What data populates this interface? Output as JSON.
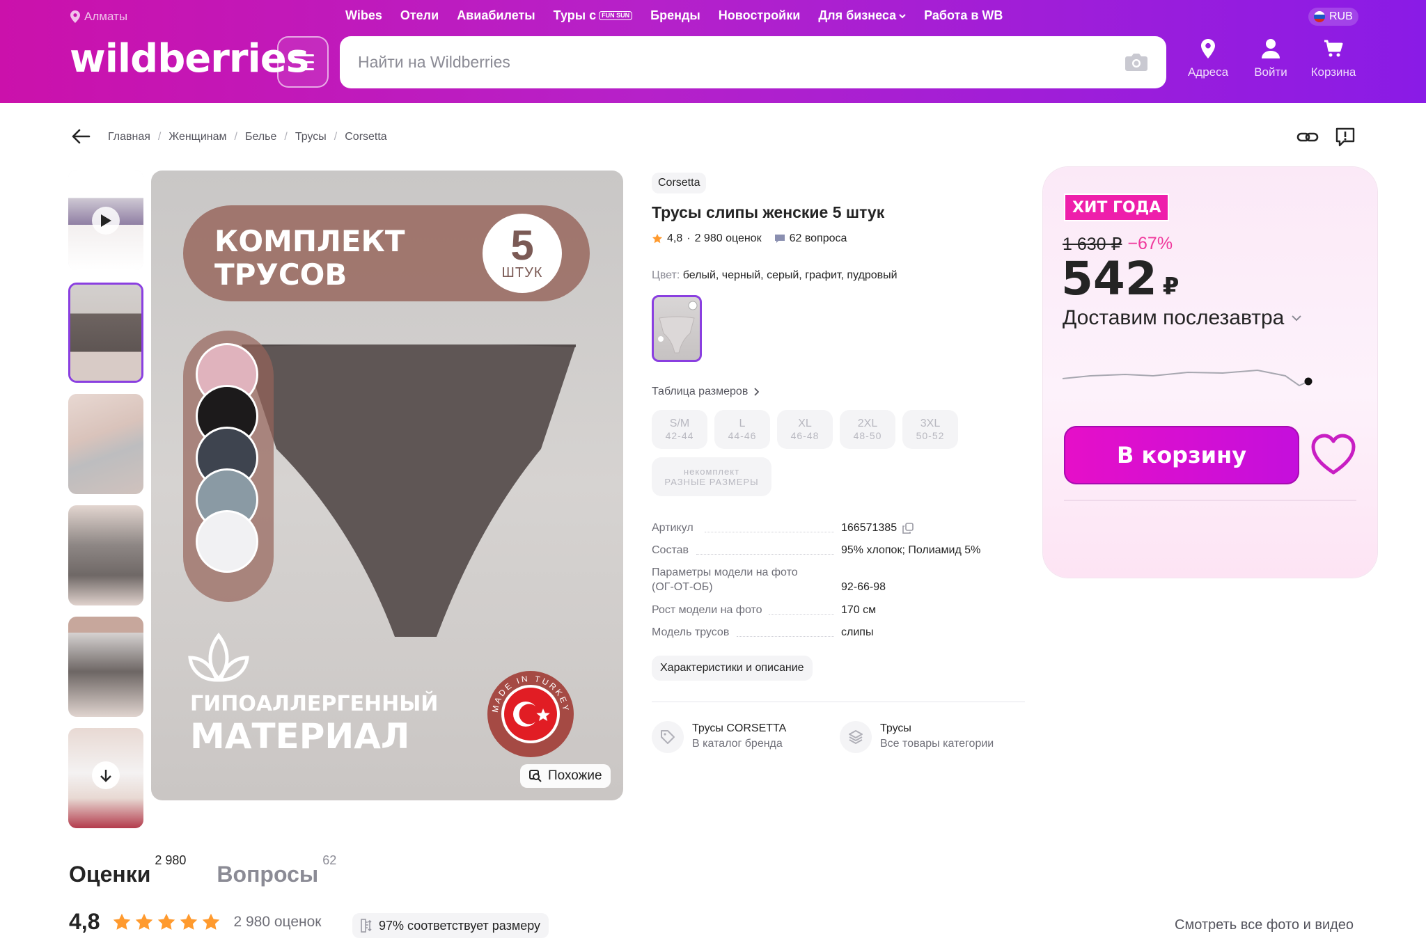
{
  "colors": {
    "accent": "#cb11ab",
    "accent_purple": "#8a1be6",
    "selected_border": "#8a3fe0",
    "discount": "#f0389c",
    "hit_badge": "#ee1fab"
  },
  "header": {
    "city": "Алматы",
    "nav": [
      "Wibes",
      "Отели",
      "Авиабилеты",
      "Туры с",
      "Бренды",
      "Новостройки",
      "Для бизнеса",
      "Работа в WB"
    ],
    "tours_badge": "FUN SUN",
    "currency": "RUB",
    "logo": "wildberries",
    "search_placeholder": "Найти на Wildberries",
    "icons": [
      {
        "name": "location-icon",
        "label": "Адреса"
      },
      {
        "name": "user-icon",
        "label": "Войти"
      },
      {
        "name": "cart-icon",
        "label": "Корзина"
      }
    ]
  },
  "breadcrumbs": [
    "Главная",
    "Женщинам",
    "Белье",
    "Трусы",
    "Corsetta"
  ],
  "gallery": {
    "banner_line1": "КОМПЛЕКТ",
    "banner_line2": "ТРУСОВ",
    "count_number": "5",
    "count_label": "ШТУК",
    "material_line1": "ГИПОАЛЛЕРГЕННЫЙ",
    "material_line2": "МАТЕРИАЛ",
    "made_in": "MADE IN TURKEY",
    "similar_button": "Похожие",
    "swatches": [
      "#e0b3bd",
      "#1c1a1b",
      "#3e444f",
      "#8a9aa4",
      "#f1f1f3"
    ]
  },
  "product": {
    "brand": "Corsetta",
    "title": "Трусы слипы женские 5 штук",
    "rating": "4,8",
    "rating_count": "2 980 оценок",
    "questions": "62 вопроса",
    "color_label": "Цвет:",
    "color_value": "белый, черный, серый, графит, пудровый",
    "size_table_link": "Таблица размеров",
    "sizes": [
      {
        "label": "S/M",
        "ru": "42-44"
      },
      {
        "label": "L",
        "ru": "44-46"
      },
      {
        "label": "XL",
        "ru": "46-48"
      },
      {
        "label": "2XL",
        "ru": "48-50"
      },
      {
        "label": "3XL",
        "ru": "50-52"
      }
    ],
    "size_other_line1": "некомплект",
    "size_other_line2": "РАЗНЫЕ РАЗМЕРЫ",
    "params": [
      {
        "key": "Артикул",
        "value": "166571385"
      },
      {
        "key": "Состав",
        "value": "95% хлопок; Полиамид 5%"
      },
      {
        "key": "Параметры модели на фото (ОГ-ОТ-ОБ)",
        "value": "92-66-98"
      },
      {
        "key": "Рост модели на фото",
        "value": "170 см"
      },
      {
        "key": "Модель трусов",
        "value": "слипы"
      }
    ],
    "characteristics_button": "Характеристики и описание",
    "brand_link_title": "Трусы CORSETTA",
    "brand_link_sub": "В каталог бренда",
    "category_link_title": "Трусы",
    "category_link_sub": "Все товары категории"
  },
  "buy": {
    "badge": "ХИТ ГОДА",
    "old_price": "1 630 ₽",
    "discount": "−67%",
    "price": "542",
    "currency_symbol": "₽",
    "delivery": "Доставим послезавтра",
    "cart_button": "В корзину"
  },
  "reviews": {
    "tab_reviews": "Оценки",
    "tab_reviews_count": "2 980",
    "tab_questions": "Вопросы",
    "tab_questions_count": "62",
    "rating": "4,8",
    "stars": 5,
    "count": "2 980 оценок",
    "fit": "97% соответствует размеру",
    "see_all": "Смотреть все фото и видео"
  }
}
